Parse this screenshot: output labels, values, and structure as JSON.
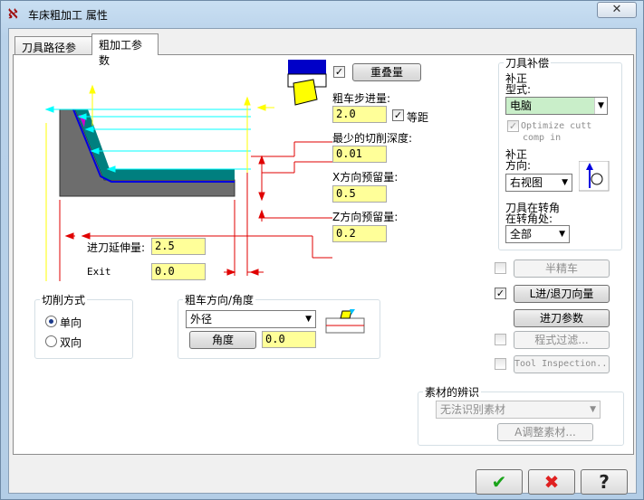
{
  "window": {
    "title": "车床粗加工 属性",
    "close_glyph": "✕"
  },
  "tabs": [
    {
      "label": "刀具路径参数"
    },
    {
      "label": "粗加工参数"
    }
  ],
  "overlap": {
    "checked": "✓",
    "button_label": "重叠量"
  },
  "rough_step": {
    "label": "粗车步进量:",
    "value": "2.0",
    "equal_checked": "✓",
    "equal_label": "等距"
  },
  "min_depth": {
    "label": "最少的切削深度:",
    "value": "0.01"
  },
  "x_stock": {
    "label": "X方向预留量:",
    "value": "0.5"
  },
  "z_stock": {
    "label": "Z方向预留量:",
    "value": "0.2"
  },
  "entry_ext": {
    "label": "进刀延伸量:",
    "value": "2.5"
  },
  "exit": {
    "label": "Exit",
    "value": "0.0"
  },
  "cut_method": {
    "title": "切削方式",
    "options": [
      {
        "label": "单向"
      },
      {
        "label": "双向"
      }
    ]
  },
  "rough_direction": {
    "title": "粗车方向/角度",
    "selected": "外径",
    "angle_button": "角度",
    "angle_value": "0.0"
  },
  "tool_comp": {
    "title": "刀具补偿",
    "type_label_1": "补正",
    "type_label_2": "型式:",
    "type_value": "电脑",
    "optimize_checked": "✓",
    "optimize_label_1": "Optimize cutt",
    "optimize_label_2": "comp in",
    "dir_label_1": "补正",
    "dir_label_2": "方向:",
    "dir_value": "右视图",
    "corner_label_1": "刀具在转角",
    "corner_label_2": "在转角处:",
    "corner_value": "全部"
  },
  "semi_finish": {
    "button": "半精车"
  },
  "lead": {
    "checked": "✓",
    "button": "L进/退刀向量"
  },
  "plunge": {
    "button": "进刀参数"
  },
  "filter": {
    "button": "程式过滤..."
  },
  "tool_inspection": {
    "button": "Tool Inspection..."
  },
  "stock_recognition": {
    "title": "素材的辨识",
    "selected": "无法识别素材",
    "adjust_button": "A调整素材..."
  },
  "footer": {
    "ok": "✔",
    "cancel": "✖",
    "help": "?"
  },
  "colors": {
    "part_gray": "#6d6d6d",
    "stock_teal": "#007f7f",
    "cyan_line": "#00ffff",
    "red_line": "#e00000",
    "yellow_arrow": "#ffff00",
    "blue_dir": "#0000e0",
    "comp_green": "#c9eec9"
  }
}
